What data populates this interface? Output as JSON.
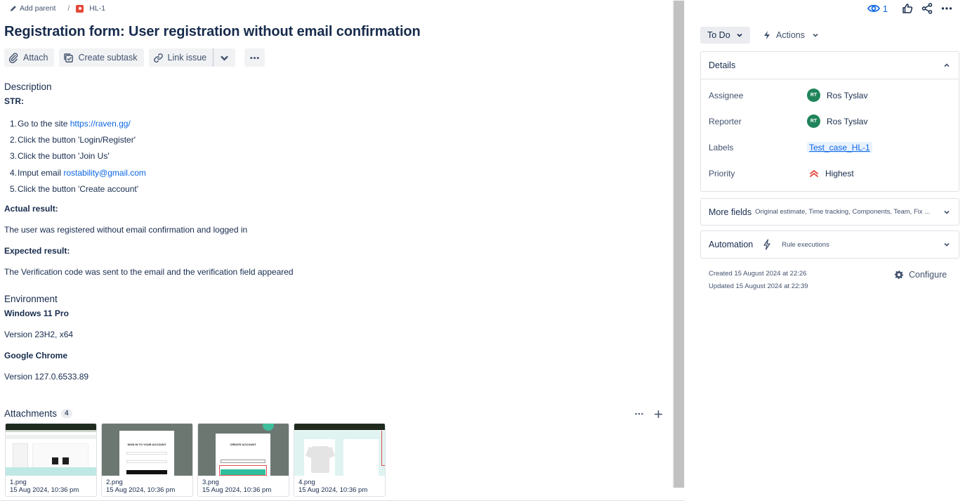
{
  "breadcrumb": {
    "add_parent": "Add parent",
    "issue_key": "HL-1"
  },
  "issue": {
    "title": "Registration form: User registration without email confirmation"
  },
  "toolbar": {
    "attach": "Attach",
    "create_subtask": "Create subtask",
    "link_issue": "Link issue"
  },
  "description": {
    "heading": "Description",
    "str_label": "STR:",
    "steps": [
      {
        "num": "1.",
        "text": "Go to the site ",
        "link": "https://raven.gg/"
      },
      {
        "num": "2.",
        "text": "Click the button 'Login/Register'"
      },
      {
        "num": "3.",
        "text": "Click the button 'Join Us'"
      },
      {
        "num": "4.",
        "text": "Imput email ",
        "link": "rostability@gmail.com"
      },
      {
        "num": "5.",
        "text": "Click the button 'Create account'"
      }
    ],
    "actual_label": "Actual result:",
    "actual_text": "The user was registered without email confirmation and logged in",
    "expected_label": "Expected result:",
    "expected_text": "The Verification code was sent to the email and the verification field appeared"
  },
  "environment": {
    "heading": "Environment",
    "os": "Windows 11 Pro",
    "os_version": "Version 23H2, x64",
    "browser": "Google Chrome",
    "browser_version": "Version 127.0.6533.89"
  },
  "attachments": {
    "heading": "Attachments",
    "count": "4",
    "items": [
      {
        "name": "1.png",
        "date": "15 Aug 2024, 10:36 pm"
      },
      {
        "name": "2.png",
        "date": "15 Aug 2024, 10:36 pm"
      },
      {
        "name": "3.png",
        "date": "15 Aug 2024, 10:36 pm"
      },
      {
        "name": "4.png",
        "date": "15 Aug 2024, 10:36 pm"
      }
    ],
    "thumb_texts": {
      "t2": "SIGN IN TO YOUR ACCOUNT",
      "t3": "CREATE ACCOUNT"
    }
  },
  "top_right": {
    "watchers": "1"
  },
  "status": {
    "current": "To Do",
    "actions": "Actions"
  },
  "details": {
    "heading": "Details",
    "assignee_label": "Assignee",
    "assignee": "Ros Tyslav",
    "assignee_initials": "RT",
    "reporter_label": "Reporter",
    "reporter": "Ros Tyslav",
    "reporter_initials": "RT",
    "labels_label": "Labels",
    "label_value": "Test_case_HL-1",
    "priority_label": "Priority",
    "priority": "Highest"
  },
  "more_fields": {
    "label": "More fields",
    "sub": "Original estimate, Time tracking, Components, Team, Fix ..."
  },
  "automation": {
    "label": "Automation",
    "sub": "Rule executions"
  },
  "meta": {
    "created": "Created 15 August 2024 at 22:26",
    "updated": "Updated 15 August 2024 at 22:39",
    "configure": "Configure"
  },
  "colors": {
    "link": "#0c66e4",
    "status_bg": "#ebecf0",
    "priority": "#e2483d",
    "avatar": "#1f845a"
  }
}
